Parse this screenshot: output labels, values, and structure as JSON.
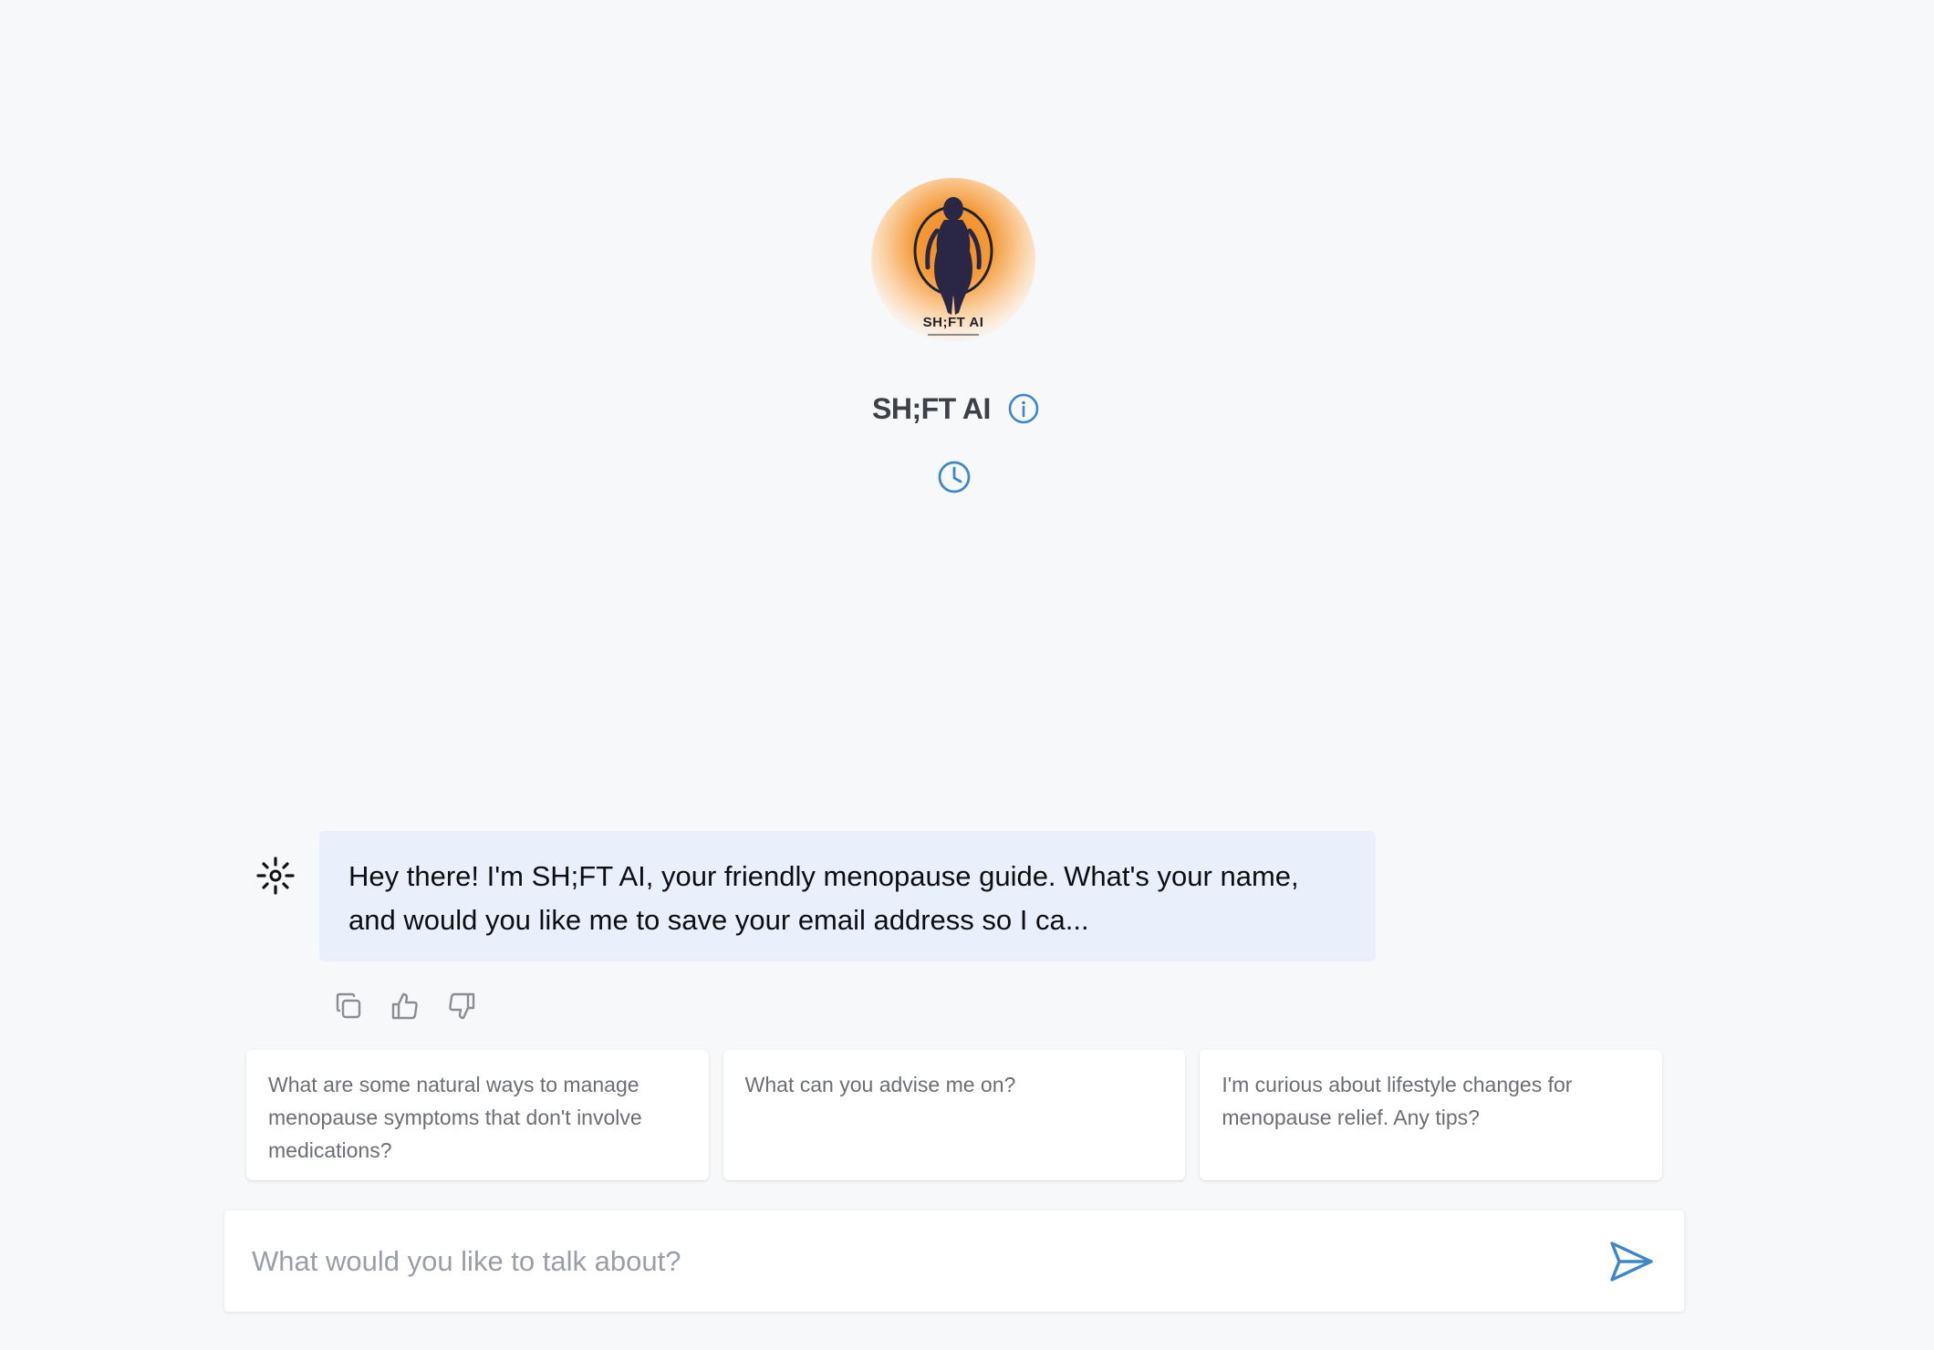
{
  "header": {
    "logo_caption": "SH;FT AI",
    "title": "SH;FT AI",
    "info_icon": "info-icon",
    "history_icon": "clock-icon"
  },
  "conversation": {
    "messages": [
      {
        "role": "assistant",
        "avatar_icon": "sparkle-icon",
        "text": "Hey there! I'm SH;FT AI, your friendly menopause guide. What's your name, and would you like me to save your email address so I ca..."
      }
    ],
    "message_actions": [
      "copy-icon",
      "thumbs-up-icon",
      "thumbs-down-icon"
    ]
  },
  "suggestions": [
    "What are some natural ways to manage menopause symptoms that don't involve medications?",
    "What can you advise me on?",
    "I'm curious about lifestyle changes for menopause relief. Any tips?"
  ],
  "composer": {
    "placeholder": "What would you like to talk about?",
    "send_icon": "send-icon"
  },
  "colors": {
    "background": "#f7f8fa",
    "accent": "#3f86c6",
    "bubble": "#e9f0fb",
    "logo_orange": "#f08a1f"
  }
}
